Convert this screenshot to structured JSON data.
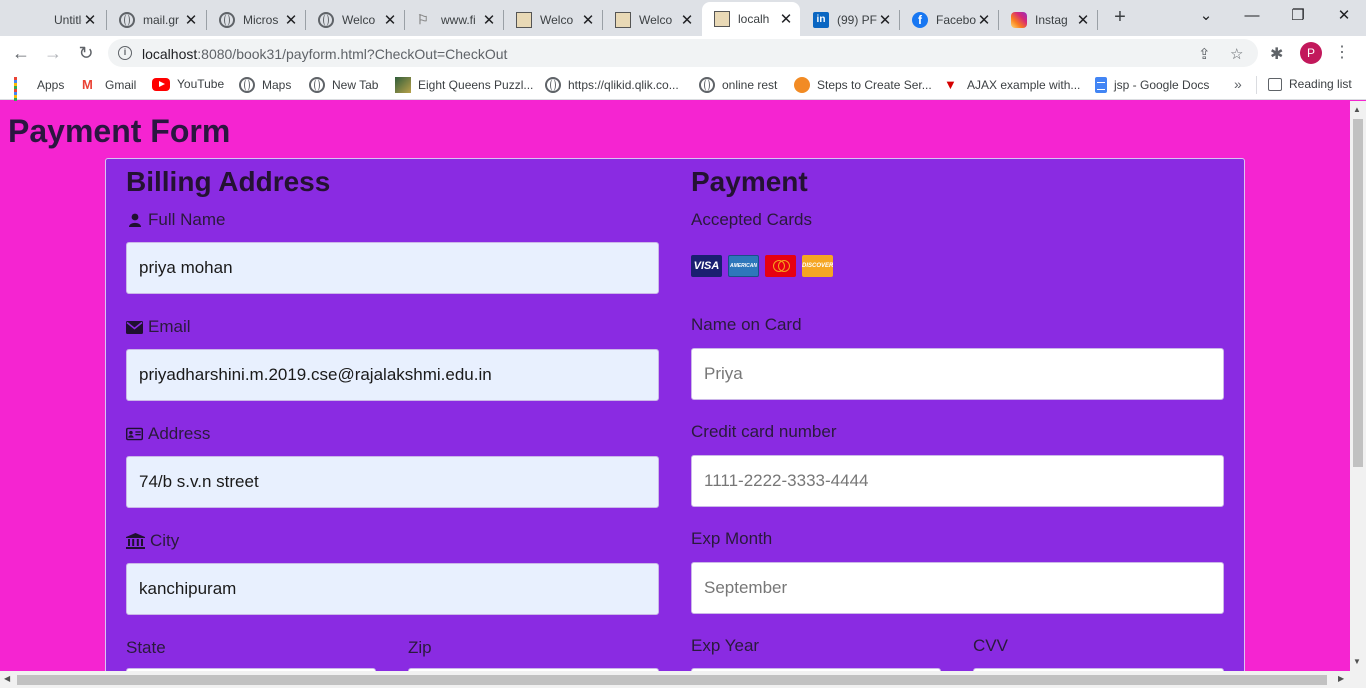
{
  "browser": {
    "tabs": [
      {
        "title": "Untitle",
        "icon": "blank"
      },
      {
        "title": "mail.gr",
        "icon": "globe"
      },
      {
        "title": "Micros",
        "icon": "globe"
      },
      {
        "title": "Welco",
        "icon": "globe"
      },
      {
        "title": "www.fi",
        "icon": "flag"
      },
      {
        "title": "Welco",
        "icon": "image"
      },
      {
        "title": "Welco",
        "icon": "image"
      },
      {
        "title": "localh",
        "icon": "image"
      },
      {
        "title": "(99) PF",
        "icon": "linkedin"
      },
      {
        "title": "Facebo",
        "icon": "facebook"
      },
      {
        "title": "Instag",
        "icon": "instagram"
      }
    ],
    "url_host": "localhost",
    "url_rest": ":8080/book31/payform.html?CheckOut=CheckOut",
    "profile_initial": "P",
    "bookmarks": [
      {
        "label": "Apps",
        "icon": "apps"
      },
      {
        "label": "Gmail",
        "icon": "gmail"
      },
      {
        "label": "YouTube",
        "icon": "youtube"
      },
      {
        "label": "Maps",
        "icon": "globe"
      },
      {
        "label": "New Tab",
        "icon": "globe"
      },
      {
        "label": "Eight Queens Puzzl...",
        "icon": "picture"
      },
      {
        "label": "https://qlikid.qlik.co...",
        "icon": "globe"
      },
      {
        "label": "online rest",
        "icon": "globe"
      },
      {
        "label": "Steps to Create Ser...",
        "icon": "steps"
      },
      {
        "label": "AJAX example with...",
        "icon": "ajax"
      },
      {
        "label": "jsp - Google Docs",
        "icon": "docs"
      }
    ],
    "reading_list": "Reading list"
  },
  "page": {
    "title": "Payment Form",
    "billing": {
      "heading": "Billing Address",
      "full_name": {
        "label": "Full Name",
        "value": "priya mohan"
      },
      "email": {
        "label": "Email",
        "value": "priyadharshini.m.2019.cse@rajalakshmi.edu.in"
      },
      "address": {
        "label": "Address",
        "value": "74/b s.v.n street"
      },
      "city": {
        "label": "City",
        "value": "kanchipuram"
      },
      "state": {
        "label": "State"
      },
      "zip": {
        "label": "Zip"
      }
    },
    "payment": {
      "heading": "Payment",
      "accepted_cards": "Accepted Cards",
      "card_brands": [
        "VISA",
        "AMERICAN EXPRESS",
        "",
        "DISCOVER"
      ],
      "name_on_card": {
        "label": "Name on Card",
        "placeholder": "Priya"
      },
      "card_number": {
        "label": "Credit card number",
        "placeholder": "1111-2222-3333-4444"
      },
      "exp_month": {
        "label": "Exp Month",
        "placeholder": "September"
      },
      "exp_year": {
        "label": "Exp Year"
      },
      "cvv": {
        "label": "CVV"
      }
    }
  },
  "colors": {
    "page_background": "#f524d1",
    "form_background": "#8a2be2",
    "autofill_field": "#e8f0fe"
  }
}
